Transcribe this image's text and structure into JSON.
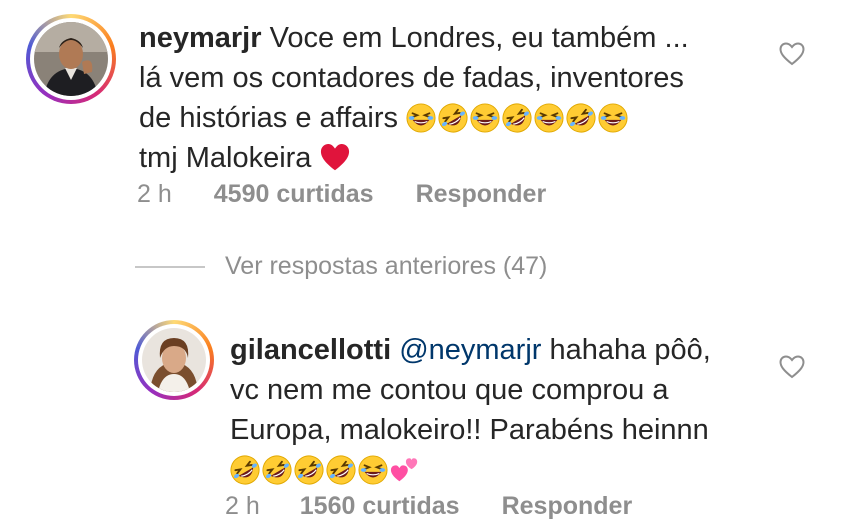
{
  "comments": [
    {
      "username": "neymarjr",
      "lines": [
        "Voce em Londres, eu também ...",
        "lá vem os contadores de fadas, inventores",
        "de histórias e affairs"
      ],
      "last_line": "tmj Malokeira",
      "time": "2 h",
      "likes": "4590 curtidas",
      "reply_label": "Responder"
    },
    {
      "username": "gilancellotti",
      "mention": "@neymarjr",
      "first_line_rest": "hahaha pôô,",
      "lines": [
        "vc nem me contou que comprou a",
        "Europa, malokeiro!! Parabéns heinnn"
      ],
      "time": "2 h",
      "likes": "1560 curtidas",
      "reply_label": "Responder"
    }
  ],
  "view_replies": {
    "label": "Ver respostas anteriores (47)"
  },
  "icons": {
    "like": "heart-outline-icon",
    "laugh": "grinning-squinting-emoji",
    "rofl": "rolling-on-floor-laughing-emoji",
    "red_heart": "red-heart-emoji",
    "two_hearts": "two-hearts-emoji"
  },
  "colors": {
    "text": "#262626",
    "muted": "#8e8e8e",
    "mention": "#00376b",
    "heart": "#e0245e"
  }
}
